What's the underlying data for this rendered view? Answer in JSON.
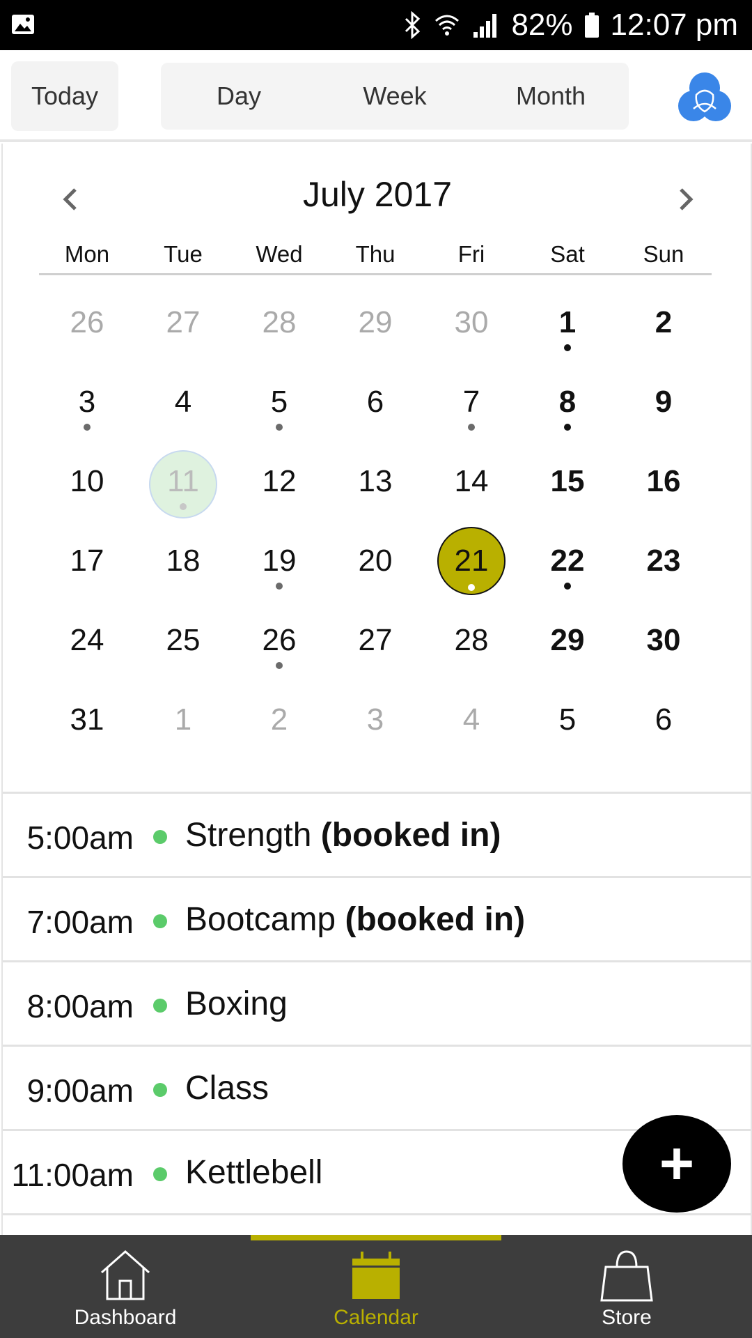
{
  "status_bar": {
    "battery": "82%",
    "time": "12:07 pm",
    "icons": [
      "gallery-icon",
      "bluetooth-icon",
      "wifi-icon",
      "signal-icon",
      "battery-icon"
    ]
  },
  "toolbar": {
    "today_label": "Today",
    "views": [
      "Day",
      "Week",
      "Month"
    ],
    "logo_icon": "app-logo-icon"
  },
  "calendar": {
    "title": "July 2017",
    "weekdays": [
      "Mon",
      "Tue",
      "Wed",
      "Thu",
      "Fri",
      "Sat",
      "Sun"
    ],
    "accent_color": "#b9b000",
    "weeks": [
      [
        {
          "d": "26",
          "o": true
        },
        {
          "d": "27",
          "o": true
        },
        {
          "d": "28",
          "o": true
        },
        {
          "d": "29",
          "o": true
        },
        {
          "d": "30",
          "o": true
        },
        {
          "d": "1",
          "dot": true
        },
        {
          "d": "2"
        }
      ],
      [
        {
          "d": "3",
          "dot": true
        },
        {
          "d": "4"
        },
        {
          "d": "5",
          "dot": true
        },
        {
          "d": "6"
        },
        {
          "d": "7",
          "dot": true
        },
        {
          "d": "8",
          "dot": true
        },
        {
          "d": "9"
        }
      ],
      [
        {
          "d": "10"
        },
        {
          "d": "11",
          "today": true,
          "dot": true
        },
        {
          "d": "12"
        },
        {
          "d": "13"
        },
        {
          "d": "14"
        },
        {
          "d": "15"
        },
        {
          "d": "16"
        }
      ],
      [
        {
          "d": "17"
        },
        {
          "d": "18"
        },
        {
          "d": "19",
          "dot": true
        },
        {
          "d": "20"
        },
        {
          "d": "21",
          "selected": true,
          "dot": true
        },
        {
          "d": "22",
          "dot": true
        },
        {
          "d": "23"
        }
      ],
      [
        {
          "d": "24"
        },
        {
          "d": "25"
        },
        {
          "d": "26",
          "dot": true
        },
        {
          "d": "27"
        },
        {
          "d": "28"
        },
        {
          "d": "29"
        },
        {
          "d": "30"
        }
      ],
      [
        {
          "d": "31"
        },
        {
          "d": "1",
          "o": true
        },
        {
          "d": "2",
          "o": true
        },
        {
          "d": "3",
          "o": true
        },
        {
          "d": "4",
          "o": true
        },
        {
          "d": "5",
          "o": true
        },
        {
          "d": "6",
          "o": true
        }
      ]
    ]
  },
  "events": [
    {
      "time": "5:00am",
      "name": "Strength",
      "status": "(booked in)"
    },
    {
      "time": "7:00am",
      "name": "Bootcamp",
      "status": "(booked in)"
    },
    {
      "time": "8:00am",
      "name": "Boxing",
      "status": ""
    },
    {
      "time": "9:00am",
      "name": "Class",
      "status": ""
    },
    {
      "time": "11:00am",
      "name": "Kettlebell",
      "status": ""
    }
  ],
  "event_dot_color": "#5bcb6a",
  "fab_label": "+",
  "bottom_nav": {
    "items": [
      {
        "label": "Dashboard",
        "icon": "home-icon"
      },
      {
        "label": "Calendar",
        "icon": "calendar-icon",
        "active": true
      },
      {
        "label": "Store",
        "icon": "shopping-bag-icon"
      }
    ]
  }
}
